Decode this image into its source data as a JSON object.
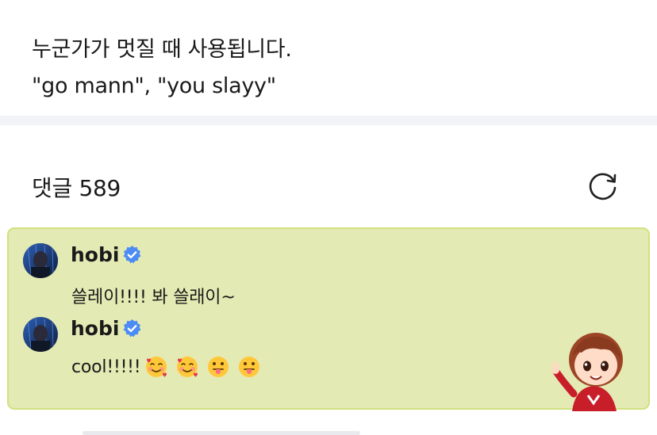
{
  "definition": {
    "line1": "누군가가 멋질 때 사용됩니다.",
    "line2": "\"go mann\", \"you slayy\""
  },
  "comments": {
    "title": "댓글 589",
    "refresh_icon": "refresh-icon",
    "accent": "#e4eab3",
    "items": [
      {
        "user": "hobi",
        "verified": true,
        "text": "쓸레이!!!! 봐 쓸래이~"
      },
      {
        "user": "hobi",
        "verified": true,
        "text": "cool!!!!!",
        "emojis": [
          "smiling-face-with-hearts",
          "smiling-face-with-hearts",
          "tongue-face",
          "tongue-face"
        ]
      }
    ]
  },
  "colors": {
    "verified": "#4d8cf5",
    "card_border": "#d2e07e",
    "background": "#ffffff"
  }
}
